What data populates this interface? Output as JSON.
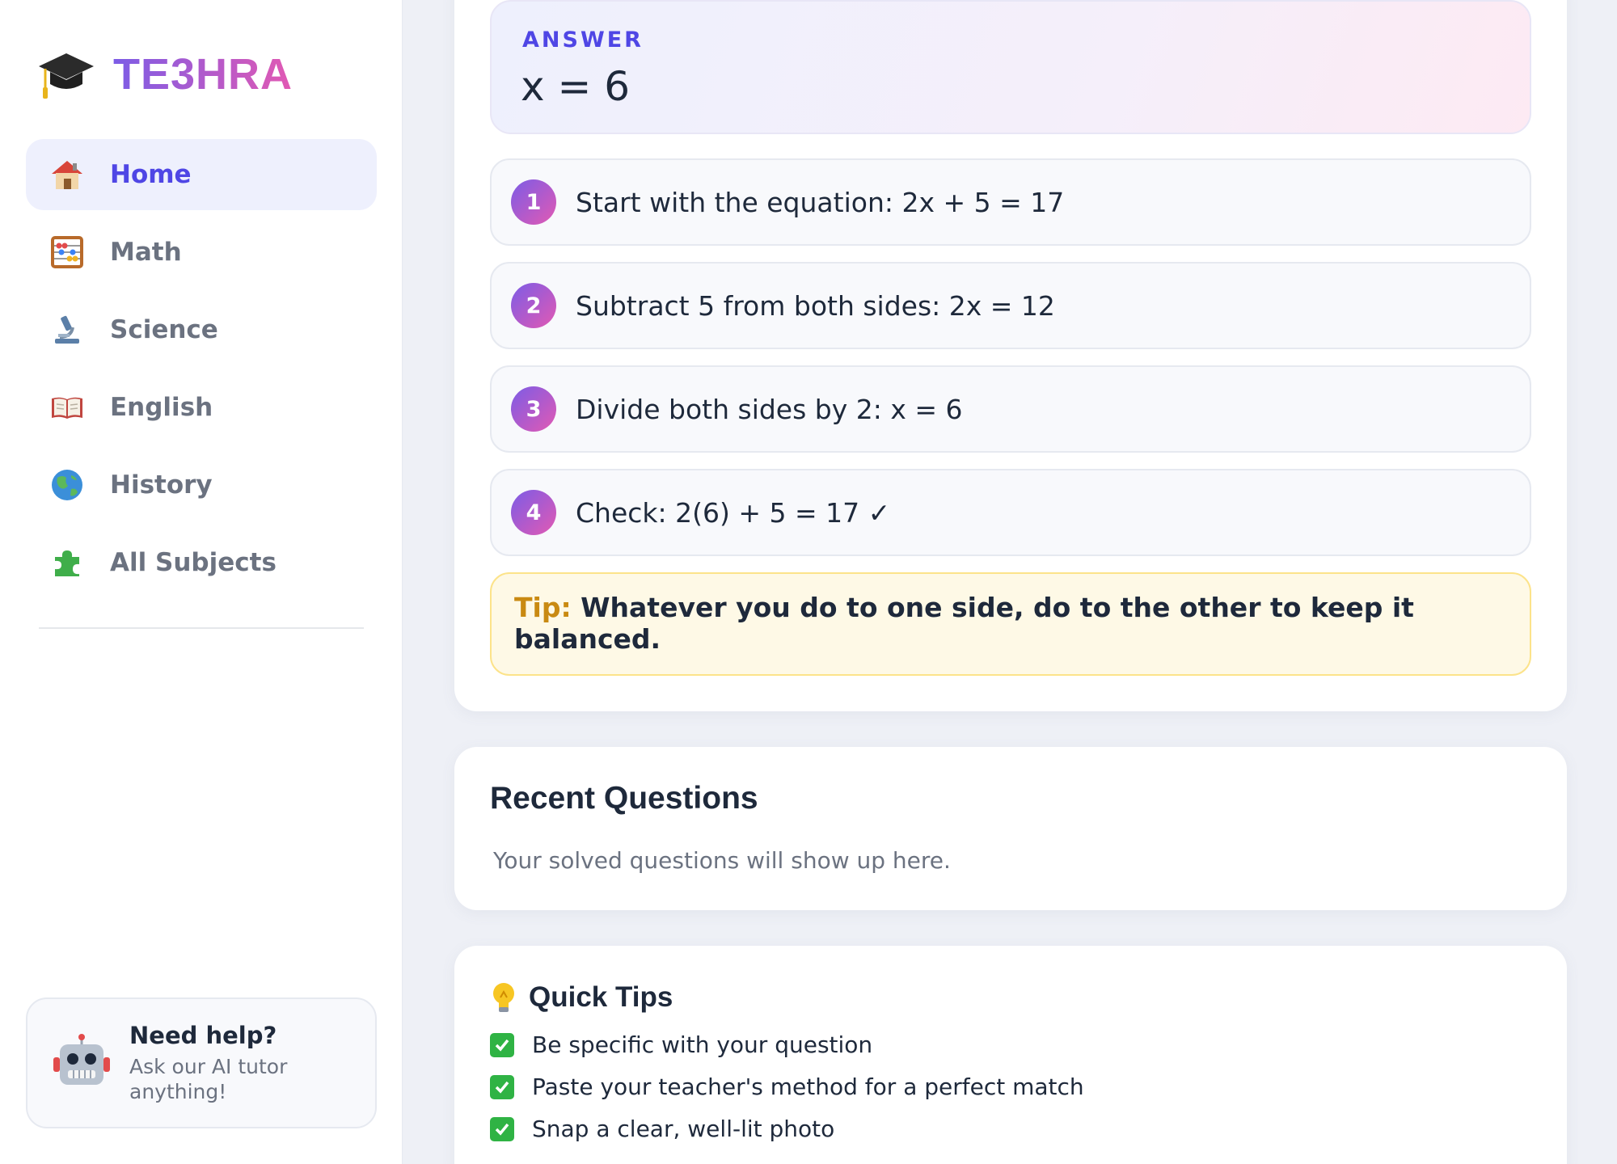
{
  "brand": {
    "name": "TE3HRA",
    "icon": "graduation-cap-icon"
  },
  "sidebar": {
    "items": [
      {
        "label": "Home",
        "icon": "house-icon",
        "active": true
      },
      {
        "label": "Math",
        "icon": "abacus-icon",
        "active": false
      },
      {
        "label": "Science",
        "icon": "microscope-icon",
        "active": false
      },
      {
        "label": "English",
        "icon": "open-book-icon",
        "active": false
      },
      {
        "label": "History",
        "icon": "globe-icon",
        "active": false
      },
      {
        "label": "All Subjects",
        "icon": "puzzle-icon",
        "active": false
      }
    ],
    "help": {
      "title": "Need help?",
      "subtitle": "Ask our AI tutor anything!",
      "icon": "robot-icon"
    }
  },
  "solution": {
    "answer_label": "ANSWER",
    "answer_value": "x = 6",
    "steps": [
      {
        "num": "1",
        "text": "Start with the equation: 2x + 5 = 17"
      },
      {
        "num": "2",
        "text": "Subtract 5 from both sides: 2x = 12"
      },
      {
        "num": "3",
        "text": "Divide both sides by 2: x = 6"
      },
      {
        "num": "4",
        "text": "Check: 2(6) + 5 = 17 ✓"
      }
    ],
    "tip": {
      "label": "Tip:",
      "text": "Whatever you do to one side, do to the other to keep it balanced."
    }
  },
  "recent": {
    "title": "Recent Questions",
    "empty_text": "Your solved questions will show up here."
  },
  "quick_tips": {
    "title": "Quick Tips",
    "icon": "lightbulb-icon",
    "items": [
      "Be specific with your question",
      "Paste your teacher's method for a perfect match",
      "Snap a clear, well-lit photo"
    ]
  },
  "colors": {
    "accent": "#4f46e5",
    "gradient_start": "#7c5ce6",
    "gradient_end": "#e259b3",
    "check": "#2fb344",
    "tip_label": "#c98a12"
  }
}
